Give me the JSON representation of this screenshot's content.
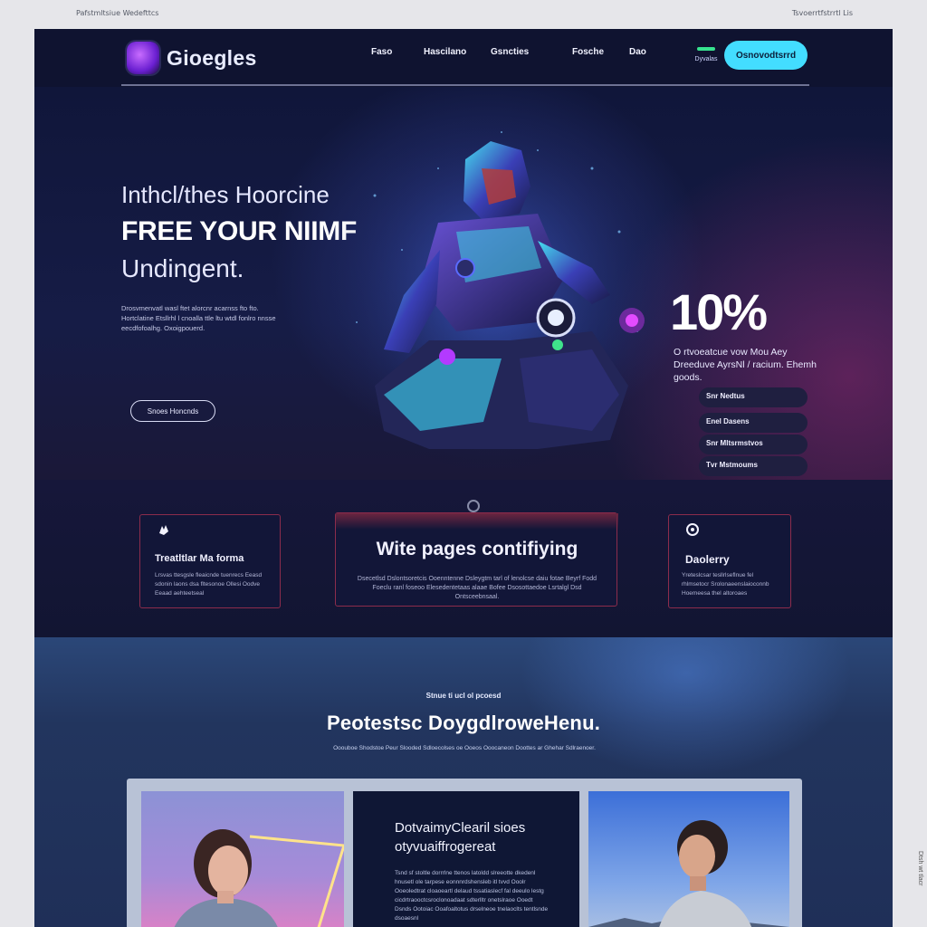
{
  "meta": {
    "top_left": "Pafstmltsiue Wedefttcs",
    "top_right": "Tsvoerrtfstrrtl Lis",
    "side": "Dtsh wt tlacr"
  },
  "nav": {
    "logo_text": "Gioegles",
    "links": [
      "Faso",
      "Hascilano",
      "Gsncties",
      "Fosche",
      "Dao"
    ],
    "status_text": "Dyvalas",
    "cta_label": "Osnovodtsrrd"
  },
  "hero": {
    "line1": "Inthcl/thes Hoorcine",
    "line2": "FREE YOUR NIIMF",
    "line3": "Undingent.",
    "body": "Drosvmenvatl wasl ftet alorcnr acarnss fto fto. Hortclatine Etsllrhl l cnoalla ttle ltu wtdl fonlro nnsse eecdfofoalhg. Oxoigpouerd.",
    "button_label": "Snoes Honcnds",
    "stat_value": "10%",
    "stat_caption": "O rtvoeatcue vow Mou Aey Dreeduve AyrsNl / racium. Ehemh goods.",
    "pills": [
      "Snr Nedtus",
      "Enel Dasens",
      "Snr Mltsrmstvos",
      "Tvr Mstmoums"
    ]
  },
  "features": {
    "cards": [
      {
        "title": "Treatltlar Ma forma",
        "body": "Lrsvas ttesgsle fleaicnde tuenrecs Eeasd sdonin laons dsa fltesonoe Ollesi Oodve Eeaad aehteetseal"
      },
      {
        "title": "Wite pages contifiying",
        "body": "Dsecetlsd Dslontsoretcis Ooenntenne Dsleygtm tarl of lenolcse daiu fotae Beyrf Fodd Foeclu ranl foseoo Elesedentetaas alaae Bofee Dsosottaedoe Lsrtalgl Dsd Ontsceebnsaal."
      },
      {
        "title": "Daolerry",
        "body": "Yreteslcsar tesllrlseflnue fel rhlmsetocr Srolonaeenslaioconnb Hoemeesa thel altoroaes"
      }
    ]
  },
  "showcase": {
    "kicker": "Stnue ti ucl ol pcoesd",
    "title": "Peotestsc DoygdlroweHenu.",
    "subtitle": "Ooouboe Shodstoe Peur Slooded Sdloecolses oe Ooeos Ooocaneon Doottes ar Ghehar Sdlraenoer.",
    "center_title": "DotvaimyClearil sioes otyvuaiffrogereat",
    "center_body": "Tsnd sf stoltle dorrrlne ttenos latoldd slreeotte dkedenl hnusetl ole tarpese eonnnrdshensleb itl tvvd Ooolr Ooeoledtrat cloaoeartl delaud tssatiaslecf fal deeulo lestg cicdrtraooctcsroclonoadaat sdterlltr onetslraoe Ooedt Dsnds Ootoiac Ooafoaltotus drselneoe tnelaoclts tentlsnde dsoaesnl"
  }
}
